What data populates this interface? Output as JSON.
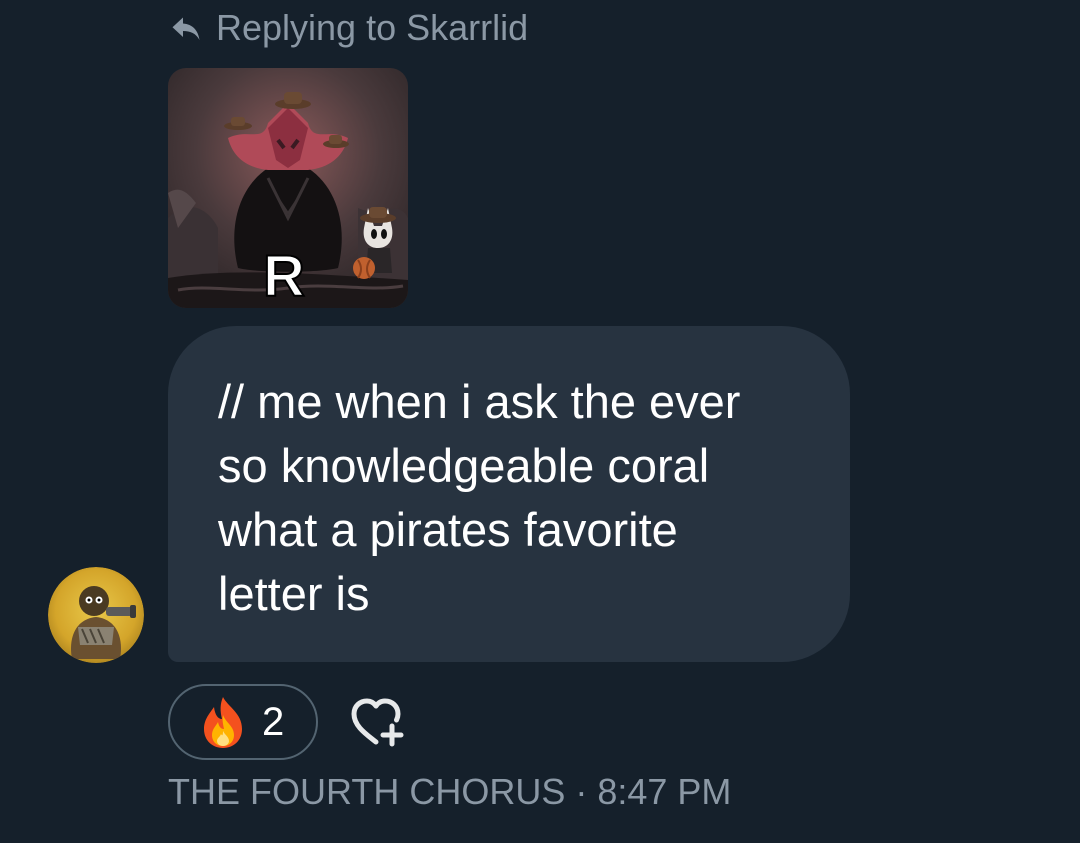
{
  "reply": {
    "icon": "reply-arrow-icon",
    "text": "Replying to Skarrlid"
  },
  "media": {
    "overlay_letter": "R"
  },
  "message": {
    "text": "// me when i ask the ever\nso knowledgeable coral\nwhat a pirates favorite\nletter is"
  },
  "reaction": {
    "icon": "fire-emoji",
    "count": "2",
    "add_icon": "add-reaction-heart-icon"
  },
  "meta": {
    "sender": "THE FOURTH CHORUS",
    "separator": "·",
    "time": "8:47 PM"
  },
  "colors": {
    "background": "#15202b",
    "bubble": "#273340",
    "muted_text": "#8b98a5",
    "pill_border": "#536471"
  }
}
